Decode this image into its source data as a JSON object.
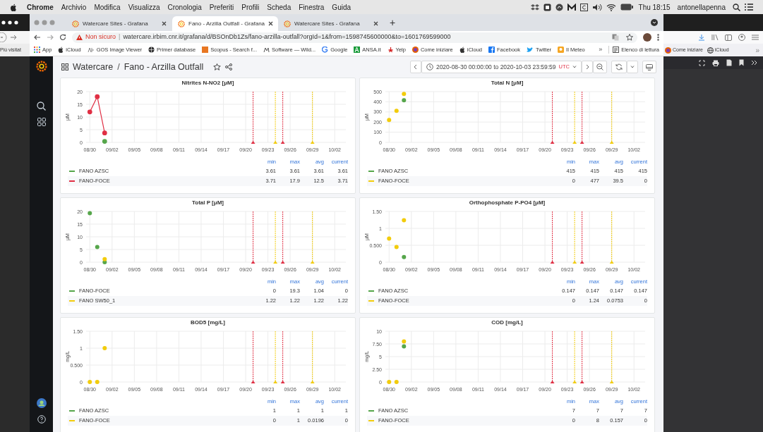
{
  "menu_bar": {
    "app": "Chrome",
    "menus": [
      "Archivio",
      "Modifica",
      "Visualizza",
      "Cronologia",
      "Preferiti",
      "Profili",
      "Scheda",
      "Finestra",
      "Guida"
    ],
    "clock": "Thu 18:15",
    "user": "antonellapenna"
  },
  "background_window_left": {
    "bookmark": "Più visitat"
  },
  "background_window_right": {
    "bookmarks": [
      "Come iniziare",
      "iCloud"
    ],
    "overflow": "»"
  },
  "browser": {
    "tabs": [
      {
        "title": "Watercare Sites - Grafana",
        "selected": false
      },
      {
        "title": "Fano - Arzilla Outfall - Grafana",
        "selected": true
      },
      {
        "title": "Watercare Sites - Grafana",
        "selected": false
      }
    ],
    "new_tab": "+",
    "address": {
      "warning": "Non sicuro",
      "separator": "|",
      "url": "watercare.irbim.cnr.it/grafana/d/BSOnDb1Zs/fano-arzilla-outfall?orgId=1&from=1598745600000&to=1601769599000"
    },
    "bookmarks": [
      "App",
      "iCloud",
      "GOS Image Viewer",
      "Primer database",
      "Scopus - Search f...",
      "Software — Wild...",
      "Google",
      "ANSA.it",
      "Yelp",
      "Come iniziare",
      "iCloud",
      "Facebook",
      "Twitter",
      "Il Meteo"
    ],
    "bookmarks_overflow": "»",
    "reading_list": "Elenco di lettura"
  },
  "dashboard": {
    "folder": "Watercare",
    "separator": "/",
    "title": "Fano - Arzilla Outfall",
    "time_range": {
      "range": "2020-08-30 00:00:00 to 2020-10-03 23:59:59",
      "timezone": "UTC"
    },
    "panels": [
      {
        "chart_data": {
          "type": "line",
          "grid": true,
          "title": "Nitrites N-NO2 [μM]",
          "ylabel": "μM",
          "ylim": [
            0,
            20
          ],
          "categories": [
            "08/30",
            null,
            null,
            "09/02",
            null,
            null,
            "09/05",
            null,
            null,
            "09/08",
            null,
            null,
            "09/11",
            null,
            null,
            "09/14",
            null,
            null,
            "09/17",
            null,
            null,
            "09/20",
            null,
            null,
            "09/23",
            null,
            null,
            "09/26",
            null,
            null,
            "09/29",
            null,
            null,
            "10/02",
            null
          ],
          "yticks": [
            {
              "value": 0,
              "label": "0"
            },
            {
              "value": 5,
              "label": "5"
            },
            {
              "value": 10,
              "label": "10"
            },
            {
              "value": 15,
              "label": "15"
            },
            {
              "value": 20,
              "label": "20"
            }
          ],
          "series": [
            {
              "name": "FANO AZSC",
              "color": "#56a64b",
              "marker": true,
              "values": [
                null,
                null,
                0.4,
                null,
                null,
                null,
                null,
                null,
                null,
                null,
                null,
                null,
                null,
                null,
                null,
                null,
                null,
                null,
                null,
                null,
                null,
                null,
                null,
                null,
                null,
                null,
                null,
                null,
                null,
                null,
                null,
                null,
                null,
                null,
                null
              ]
            },
            {
              "name": "FANO-FOCE",
              "color": "#e02f44",
              "marker": true,
              "values": [
                12,
                18,
                3.7,
                null,
                null,
                null,
                null,
                null,
                null,
                null,
                null,
                null,
                null,
                null,
                null,
                null,
                null,
                null,
                null,
                null,
                null,
                null,
                null,
                null,
                null,
                null,
                null,
                null,
                null,
                null,
                null,
                null,
                null,
                null,
                null
              ]
            }
          ]
        },
        "legend": {
          "columns": [
            "min",
            "max",
            "avg",
            "current"
          ],
          "rows": [
            [
              "3.61",
              "3.61",
              "3.61",
              "3.61"
            ],
            [
              "3.71",
              "17.9",
              "12.5",
              "3.71"
            ]
          ]
        }
      },
      {
        "chart_data": {
          "type": "scatter",
          "grid": true,
          "title": "Total N [μM]",
          "ylabel": "μM",
          "ylim": [
            0,
            500
          ],
          "categories": [
            "08/30",
            null,
            null,
            "09/02",
            null,
            null,
            "09/05",
            null,
            null,
            "09/08",
            null,
            null,
            "09/11",
            null,
            null,
            "09/14",
            null,
            null,
            "09/17",
            null,
            null,
            "09/20",
            null,
            null,
            "09/23",
            null,
            null,
            "09/26",
            null,
            null,
            "09/29",
            null,
            null,
            "10/02",
            null
          ],
          "yticks": [
            {
              "value": 0,
              "label": "0"
            },
            {
              "value": 100,
              "label": "100"
            },
            {
              "value": 200,
              "label": "200"
            },
            {
              "value": 300,
              "label": "300"
            },
            {
              "value": 400,
              "label": "400"
            },
            {
              "value": 500,
              "label": "500"
            }
          ],
          "series": [
            {
              "name": "FANO AZSC",
              "color": "#56a64b",
              "values": [
                null,
                null,
                415,
                null,
                null,
                null,
                null,
                null,
                null,
                null,
                null,
                null,
                null,
                null,
                null,
                null,
                null,
                null,
                null,
                null,
                null,
                null,
                null,
                null,
                null,
                null,
                null,
                null,
                null,
                null,
                null,
                null,
                null,
                null,
                null
              ]
            },
            {
              "name": "FANO-FOCE",
              "color": "#f2cc0c",
              "values": [
                220,
                310,
                477,
                null,
                null,
                null,
                null,
                null,
                null,
                null,
                null,
                null,
                null,
                null,
                null,
                null,
                null,
                null,
                null,
                null,
                null,
                null,
                null,
                null,
                null,
                null,
                null,
                null,
                null,
                null,
                null,
                null,
                null,
                null,
                null
              ]
            }
          ]
        },
        "legend": {
          "columns": [
            "min",
            "max",
            "avg",
            "current"
          ],
          "rows": [
            [
              "415",
              "415",
              "415",
              "415"
            ],
            [
              "0",
              "477",
              "39.5",
              "0"
            ]
          ]
        }
      },
      {
        "chart_data": {
          "type": "scatter",
          "grid": true,
          "title": "Total P [μM]",
          "ylabel": "μM",
          "ylim": [
            0,
            20
          ],
          "categories": [
            "08/30",
            null,
            null,
            "09/02",
            null,
            null,
            "09/05",
            null,
            null,
            "09/08",
            null,
            null,
            "09/11",
            null,
            null,
            "09/14",
            null,
            null,
            "09/17",
            null,
            null,
            "09/20",
            null,
            null,
            "09/23",
            null,
            null,
            "09/26",
            null,
            null,
            "09/29",
            null,
            null,
            "10/02",
            null
          ],
          "yticks": [
            {
              "value": 0,
              "label": "0"
            },
            {
              "value": 5,
              "label": "5"
            },
            {
              "value": 10,
              "label": "10"
            },
            {
              "value": 15,
              "label": "15"
            },
            {
              "value": 20,
              "label": "20"
            }
          ],
          "series": [
            {
              "name": "FANO-FOCE",
              "color": "#56a64b",
              "values": [
                19.3,
                6,
                0,
                null,
                null,
                null,
                null,
                null,
                null,
                null,
                null,
                null,
                null,
                null,
                null,
                null,
                null,
                null,
                null,
                null,
                null,
                null,
                null,
                null,
                null,
                null,
                null,
                null,
                null,
                null,
                null,
                null,
                null,
                null,
                null
              ]
            },
            {
              "name": "FANO SW50_1",
              "color": "#f2cc0c",
              "values": [
                null,
                null,
                1.2,
                null,
                null,
                null,
                null,
                null,
                null,
                null,
                null,
                null,
                null,
                null,
                null,
                null,
                null,
                null,
                null,
                null,
                null,
                null,
                null,
                null,
                null,
                null,
                null,
                null,
                null,
                null,
                null,
                null,
                null,
                null,
                null
              ]
            }
          ]
        },
        "legend": {
          "columns": [
            "min",
            "max",
            "avg",
            "current"
          ],
          "rows": [
            [
              "0",
              "19.3",
              "1.04",
              "0"
            ],
            [
              "1.22",
              "1.22",
              "1.22",
              "1.22"
            ]
          ]
        }
      },
      {
        "chart_data": {
          "type": "scatter",
          "grid": true,
          "title": "Orthophosphate P-PO4 [μM]",
          "ylabel": "μM",
          "ylim": [
            0,
            1.5
          ],
          "categories": [
            "08/30",
            null,
            null,
            "09/02",
            null,
            null,
            "09/05",
            null,
            null,
            "09/08",
            null,
            null,
            "09/11",
            null,
            null,
            "09/14",
            null,
            null,
            "09/17",
            null,
            null,
            "09/20",
            null,
            null,
            "09/23",
            null,
            null,
            "09/26",
            null,
            null,
            "09/29",
            null,
            null,
            "10/02",
            null
          ],
          "yticks": [
            {
              "value": 0,
              "label": "0"
            },
            {
              "value": 0.5,
              "label": "0.500"
            },
            {
              "value": 1,
              "label": "1"
            },
            {
              "value": 1.5,
              "label": "1.50"
            }
          ],
          "series": [
            {
              "name": "FANO AZSC",
              "color": "#56a64b",
              "values": [
                null,
                null,
                0.15,
                null,
                null,
                null,
                null,
                null,
                null,
                null,
                null,
                null,
                null,
                null,
                null,
                null,
                null,
                null,
                null,
                null,
                null,
                null,
                null,
                null,
                null,
                null,
                null,
                null,
                null,
                null,
                null,
                null,
                null,
                null,
                null
              ]
            },
            {
              "name": "FANO-FOCE",
              "color": "#f2cc0c",
              "values": [
                0.7,
                0.45,
                1.24,
                null,
                null,
                null,
                null,
                null,
                null,
                null,
                null,
                null,
                null,
                null,
                null,
                null,
                null,
                null,
                null,
                null,
                null,
                null,
                null,
                null,
                null,
                null,
                null,
                null,
                null,
                null,
                null,
                null,
                null,
                null,
                null
              ]
            }
          ]
        },
        "legend": {
          "columns": [
            "min",
            "max",
            "avg",
            "current"
          ],
          "rows": [
            [
              "0.147",
              "0.147",
              "0.147",
              "0.147"
            ],
            [
              "0",
              "1.24",
              "0.0753",
              "0"
            ]
          ]
        }
      },
      {
        "chart_data": {
          "type": "scatter",
          "grid": true,
          "title": "BOD5 [mg/L]",
          "ylabel": "mg/L",
          "ylim": [
            0,
            1.5
          ],
          "categories": [
            "08/30",
            null,
            null,
            "09/02",
            null,
            null,
            "09/05",
            null,
            null,
            "09/08",
            null,
            null,
            "09/11",
            null,
            null,
            "09/14",
            null,
            null,
            "09/17",
            null,
            null,
            "09/20",
            null,
            null,
            "09/23",
            null,
            null,
            "09/26",
            null,
            null,
            "09/29",
            null,
            null,
            "10/02",
            null
          ],
          "yticks": [
            {
              "value": 0,
              "label": "0"
            },
            {
              "value": 0.5,
              "label": "0.500"
            },
            {
              "value": 1,
              "label": "1"
            },
            {
              "value": 1.5,
              "label": "1.50"
            }
          ],
          "series": [
            {
              "name": "FANO AZSC",
              "color": "#56a64b",
              "values": [
                null,
                null,
                null,
                null,
                null,
                null,
                null,
                null,
                null,
                null,
                null,
                null,
                null,
                null,
                null,
                null,
                null,
                null,
                null,
                null,
                null,
                null,
                null,
                null,
                null,
                null,
                null,
                null,
                null,
                null,
                null,
                null,
                null,
                null,
                null
              ]
            },
            {
              "name": "FANO-FOCE",
              "color": "#f2cc0c",
              "values": [
                0,
                0,
                1,
                null,
                null,
                null,
                null,
                null,
                null,
                null,
                null,
                null,
                null,
                null,
                null,
                null,
                null,
                null,
                null,
                null,
                null,
                null,
                null,
                null,
                null,
                null,
                null,
                null,
                null,
                null,
                null,
                null,
                null,
                null,
                null
              ]
            }
          ]
        },
        "legend": {
          "columns": [
            "min",
            "max",
            "avg",
            "current"
          ],
          "rows": [
            [
              "1",
              "1",
              "1",
              "1"
            ],
            [
              "0",
              "1",
              "0.0196",
              "0"
            ]
          ]
        }
      },
      {
        "chart_data": {
          "type": "scatter",
          "grid": true,
          "title": "COD [mg/L]",
          "ylabel": "mg/L",
          "ylim": [
            0,
            10
          ],
          "categories": [
            "08/30",
            null,
            null,
            "09/02",
            null,
            null,
            "09/05",
            null,
            null,
            "09/08",
            null,
            null,
            "09/11",
            null,
            null,
            "09/14",
            null,
            null,
            "09/17",
            null,
            null,
            "09/20",
            null,
            null,
            "09/23",
            null,
            null,
            "09/26",
            null,
            null,
            "09/29",
            null,
            null,
            "10/02",
            null
          ],
          "yticks": [
            {
              "value": 0,
              "label": "0"
            },
            {
              "value": 2.5,
              "label": "2.50"
            },
            {
              "value": 5,
              "label": "5"
            },
            {
              "value": 7.5,
              "label": "7.50"
            },
            {
              "value": 10,
              "label": "10"
            }
          ],
          "series": [
            {
              "name": "FANO AZSC",
              "color": "#56a64b",
              "values": [
                null,
                null,
                7,
                null,
                null,
                null,
                null,
                null,
                null,
                null,
                null,
                null,
                null,
                null,
                null,
                null,
                null,
                null,
                null,
                null,
                null,
                null,
                null,
                null,
                null,
                null,
                null,
                null,
                null,
                null,
                null,
                null,
                null,
                null,
                null
              ]
            },
            {
              "name": "FANO-FOCE",
              "color": "#f2cc0c",
              "values": [
                0,
                0,
                8,
                null,
                null,
                null,
                null,
                null,
                null,
                null,
                null,
                null,
                null,
                null,
                null,
                null,
                null,
                null,
                null,
                null,
                null,
                null,
                null,
                null,
                null,
                null,
                null,
                null,
                null,
                null,
                null,
                null,
                null,
                null,
                null
              ]
            }
          ]
        },
        "legend": {
          "columns": [
            "min",
            "max",
            "avg",
            "current"
          ],
          "rows": [
            [
              "7",
              "7",
              "7",
              "7"
            ],
            [
              "0",
              "8",
              "0.157",
              "0"
            ]
          ]
        }
      }
    ]
  }
}
